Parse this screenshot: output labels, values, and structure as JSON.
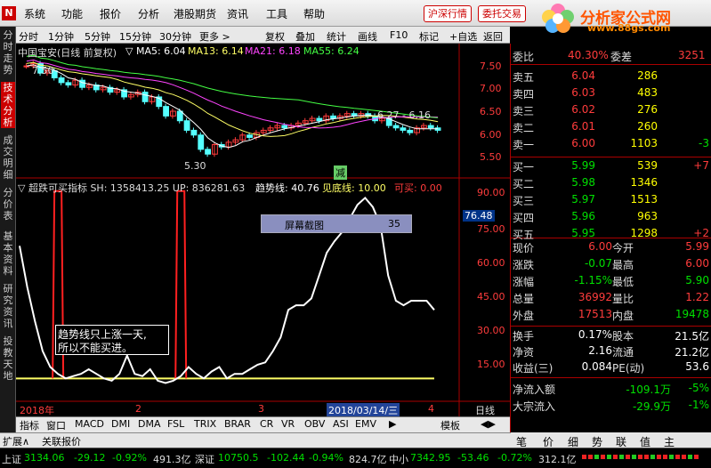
{
  "menu": {
    "items": [
      "系统",
      "功能",
      "报价",
      "分析",
      "港股期货",
      "资讯",
      "工具",
      "帮助"
    ],
    "btn_deep": "沪深行情",
    "btn_trade": "委托交易"
  },
  "brand": {
    "name": "分析家公式网",
    "url": "www.88gs.com",
    "bg_faint": "0099 4 99 4 99"
  },
  "toolbar": {
    "left": [
      "分时",
      "1分钟",
      "5分钟",
      "15分钟",
      "30分钟",
      "更多 >"
    ],
    "right": [
      "复权",
      "叠加",
      "统计",
      "画线",
      "F10",
      "标记",
      "+自选",
      "返回"
    ]
  },
  "left_tabs": [
    "分时走势",
    "技术分析",
    "成交明细",
    "分价表",
    "基本资料",
    "研究资讯",
    "投教天地"
  ],
  "kline": {
    "header_name": "中国宝安(日线 前复权)",
    "ma5": "▽ MA5: 6.04",
    "ma13": "MA13: 6.14",
    "ma21": "MA21: 6.18",
    "ma55": "MA55: 6.24",
    "high_label": "7.50",
    "low_label": "5.30",
    "range_label": "6.27 - 6.16",
    "reduce_tag": "减",
    "y_ticks": [
      "7.50",
      "7.00",
      "6.50",
      "6.00",
      "5.50"
    ]
  },
  "indicator": {
    "header": "▽ 超跌可买指标  SH: 1358413.25  UP: 836281.63",
    "trend": "趋势线: 40.76",
    "bottom": "见底线: 10.00",
    "buy": "可买: 0.00",
    "y_ticks": [
      "90.00",
      "75.00",
      "60.00",
      "45.00",
      "30.00",
      "15.00"
    ],
    "current": "76.48",
    "screenshot_box_label": "屏幕截图",
    "screenshot_box_value": "35",
    "note_line1": "趋势线只上涨一天,",
    "note_line2": "所以不能买进。"
  },
  "x_axis": {
    "year": "2018年",
    "m2": "2",
    "m3": "3",
    "m4": "4",
    "date": "2018/03/14/三",
    "period": "日线"
  },
  "index_tabs": [
    "指标",
    "窗口",
    "MACD",
    "DMI",
    "DMA",
    "FSL",
    "TRIX",
    "BRAR",
    "CR",
    "VR",
    "OBV",
    "ASI",
    "EMV",
    "▶",
    "模板",
    "◀▶"
  ],
  "status_tabs": {
    "expand": "扩展∧",
    "related": "关联报价"
  },
  "right_bottom_tabs": [
    "笔",
    "价",
    "细",
    "势",
    "联",
    "值",
    "主"
  ],
  "order_book": {
    "weibi_label": "委比",
    "weibi": "40.30%",
    "weicha_label": "委差",
    "weicha": "3251",
    "sells": [
      {
        "label": "卖五",
        "price": "6.04",
        "vol": "286",
        "chg": ""
      },
      {
        "label": "卖四",
        "price": "6.03",
        "vol": "483",
        "chg": ""
      },
      {
        "label": "卖三",
        "price": "6.02",
        "vol": "276",
        "chg": ""
      },
      {
        "label": "卖二",
        "price": "6.01",
        "vol": "260",
        "chg": ""
      },
      {
        "label": "卖一",
        "price": "6.00",
        "vol": "1103",
        "chg": "-3"
      }
    ],
    "buys": [
      {
        "label": "买一",
        "price": "5.99",
        "vol": "539",
        "chg": "+7"
      },
      {
        "label": "买二",
        "price": "5.98",
        "vol": "1346",
        "chg": ""
      },
      {
        "label": "买三",
        "price": "5.97",
        "vol": "1513",
        "chg": ""
      },
      {
        "label": "买四",
        "price": "5.96",
        "vol": "963",
        "chg": ""
      },
      {
        "label": "买五",
        "price": "5.95",
        "vol": "1298",
        "chg": "+2"
      }
    ]
  },
  "quote": {
    "rows": [
      {
        "l1": "现价",
        "v1": "6.00",
        "l2": "今开",
        "v2": "5.99"
      },
      {
        "l1": "涨跌",
        "v1": "-0.07",
        "l2": "最高",
        "v2": "6.00"
      },
      {
        "l1": "涨幅",
        "v1": "-1.15%",
        "l2": "最低",
        "v2": "5.90"
      },
      {
        "l1": "总量",
        "v1": "36992",
        "l2": "量比",
        "v2": "1.22"
      },
      {
        "l1": "外盘",
        "v1": "17513",
        "l2": "内盘",
        "v2": "19478"
      }
    ],
    "rows2": [
      {
        "l1": "换手",
        "v1": "0.17%",
        "l2": "股本",
        "v2": "21.5亿"
      },
      {
        "l1": "净资",
        "v1": "2.16",
        "l2": "流通",
        "v2": "21.2亿"
      },
      {
        "l1": "收益(三)",
        "v1": "0.084",
        "l2": "PE(动)",
        "v2": "53.6"
      }
    ],
    "flow": [
      {
        "l": "净流入额",
        "v": "-109.1万",
        "p": "-5%"
      },
      {
        "l": "大宗流入",
        "v": "-29.9万",
        "p": "-1%"
      }
    ]
  },
  "ticker": {
    "sh_label": "上证",
    "sh": "3134.06",
    "sh_chg": "-29.12",
    "sh_pct": "-0.92%",
    "sh_amt": "491.3亿",
    "sz_label": "深证",
    "sz": "10750.5",
    "sz_chg": "-102.44",
    "sz_pct": "-0.94%",
    "sz_amt": "824.7亿",
    "zx_label": "中小",
    "zx": "7342.95",
    "zx_chg": "-53.46",
    "zx_pct": "-0.72%",
    "zx_amt": "312.1亿"
  },
  "chart_data": {
    "type": "line",
    "title": "超跌可买指标",
    "trend_line": [
      68,
      50,
      35,
      22,
      15,
      12,
      10,
      11,
      12,
      14,
      12,
      10,
      9,
      12,
      20,
      12,
      11,
      14,
      9,
      8,
      9,
      11,
      15,
      12,
      10,
      13,
      15,
      10,
      12,
      12,
      14,
      16,
      17,
      22,
      28,
      40,
      42,
      42,
      45,
      55,
      65,
      70,
      74,
      80,
      86,
      89,
      85,
      77,
      55,
      44,
      42,
      44,
      44,
      44,
      40
    ],
    "bottom_line": 10,
    "buy_spikes": [
      5,
      21
    ],
    "ylim": [
      0,
      95
    ]
  }
}
